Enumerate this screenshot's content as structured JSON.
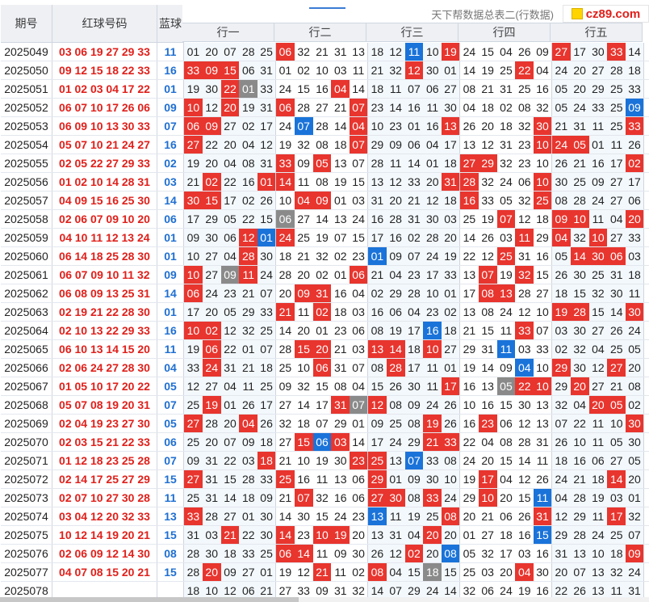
{
  "header": {
    "period_label": "期号",
    "red_label": "红球号码",
    "blue_label": "蓝球",
    "table_title": "天下帮数据总表二(行数据)",
    "groups": [
      "行一",
      "行二",
      "行三",
      "行四",
      "行五"
    ],
    "logo_text": "cz89.com"
  },
  "colors": {
    "red": "#e8352e",
    "blue": "#1a73d9",
    "gray": "#8a8a8a"
  },
  "rows": [
    {
      "period": "2025049",
      "red": "03 06 19 27 29 33",
      "blue": "11",
      "cells": [
        "01",
        "20",
        "07",
        "28",
        "25",
        "06",
        "32",
        "21",
        "31",
        "13",
        "18",
        "12",
        "11",
        "10",
        "19",
        "24",
        "15",
        "04",
        "26",
        "09",
        "27",
        "17",
        "30",
        "33",
        "14"
      ],
      "marks": {
        "5": "r",
        "12": "b",
        "14": "r",
        "20": "r",
        "23": "r"
      }
    },
    {
      "period": "2025050",
      "red": "09 12 15 18 22 33",
      "blue": "16",
      "cells": [
        "33",
        "09",
        "15",
        "06",
        "31",
        "01",
        "02",
        "10",
        "03",
        "11",
        "21",
        "32",
        "12",
        "30",
        "01",
        "14",
        "19",
        "25",
        "22",
        "04",
        "24",
        "20",
        "27",
        "28",
        "18"
      ],
      "marks": {
        "0": "r",
        "1": "r",
        "2": "r",
        "12": "r",
        "18": "r"
      }
    },
    {
      "period": "2025051",
      "red": "01 02 03 04 17 22",
      "blue": "01",
      "cells": [
        "19",
        "30",
        "22",
        "01",
        "33",
        "24",
        "15",
        "16",
        "04",
        "14",
        "18",
        "11",
        "07",
        "06",
        "27",
        "08",
        "21",
        "31",
        "25",
        "16",
        "05",
        "20",
        "29",
        "25",
        "33"
      ],
      "marks": {
        "2": "r",
        "3": "g",
        "8": "r"
      }
    },
    {
      "period": "2025052",
      "red": "06 07 10 17 26 06",
      "blue": "09",
      "cells": [
        "10",
        "12",
        "20",
        "19",
        "31",
        "06",
        "28",
        "27",
        "21",
        "07",
        "23",
        "14",
        "16",
        "11",
        "30",
        "04",
        "18",
        "02",
        "08",
        "32",
        "05",
        "24",
        "33",
        "25",
        "09"
      ],
      "marks": {
        "0": "r",
        "2": "r",
        "5": "r",
        "9": "r",
        "24": "b"
      }
    },
    {
      "period": "2025053",
      "red": "06 09 10 13 30 33",
      "blue": "07",
      "cells": [
        "06",
        "09",
        "27",
        "02",
        "17",
        "24",
        "07",
        "28",
        "14",
        "04",
        "10",
        "23",
        "01",
        "16",
        "13",
        "26",
        "20",
        "18",
        "32",
        "30",
        "21",
        "31",
        "11",
        "25",
        "33"
      ],
      "marks": {
        "0": "r",
        "1": "r",
        "6": "b",
        "9": "r",
        "14": "r",
        "19": "r",
        "24": "r"
      }
    },
    {
      "period": "2025054",
      "red": "05 07 10 21 24 27",
      "blue": "16",
      "cells": [
        "27",
        "22",
        "20",
        "04",
        "12",
        "19",
        "32",
        "08",
        "18",
        "07",
        "29",
        "09",
        "06",
        "04",
        "17",
        "13",
        "12",
        "31",
        "23",
        "10",
        "24",
        "05",
        "01",
        "11",
        "26"
      ],
      "marks": {
        "0": "r",
        "9": "r",
        "19": "r",
        "20": "r",
        "21": "r"
      }
    },
    {
      "period": "2025055",
      "red": "02 05 22 27 29 33",
      "blue": "02",
      "cells": [
        "19",
        "20",
        "04",
        "08",
        "31",
        "33",
        "09",
        "05",
        "13",
        "07",
        "28",
        "11",
        "14",
        "01",
        "18",
        "27",
        "29",
        "32",
        "23",
        "10",
        "26",
        "21",
        "16",
        "17",
        "02"
      ],
      "marks": {
        "5": "r",
        "7": "r",
        "15": "r",
        "16": "r",
        "24": "r"
      }
    },
    {
      "period": "2025056",
      "red": "01 02 10 14 28 31",
      "blue": "03",
      "cells": [
        "21",
        "02",
        "22",
        "16",
        "01",
        "14",
        "11",
        "08",
        "19",
        "15",
        "13",
        "12",
        "33",
        "20",
        "31",
        "28",
        "32",
        "24",
        "06",
        "10",
        "30",
        "25",
        "09",
        "27",
        "17"
      ],
      "marks": {
        "1": "r",
        "4": "r",
        "5": "r",
        "14": "r",
        "15": "r",
        "19": "r"
      }
    },
    {
      "period": "2025057",
      "red": "04 09 15 16 25 30",
      "blue": "14",
      "cells": [
        "30",
        "15",
        "17",
        "02",
        "26",
        "10",
        "04",
        "09",
        "01",
        "03",
        "31",
        "20",
        "21",
        "12",
        "18",
        "16",
        "33",
        "05",
        "32",
        "25",
        "08",
        "28",
        "24",
        "27",
        "06"
      ],
      "marks": {
        "0": "r",
        "1": "r",
        "6": "r",
        "7": "r",
        "15": "r",
        "19": "r"
      }
    },
    {
      "period": "2025058",
      "red": "02 06 07 09 10 20",
      "blue": "06",
      "cells": [
        "17",
        "29",
        "05",
        "22",
        "15",
        "06",
        "27",
        "14",
        "13",
        "24",
        "16",
        "28",
        "31",
        "30",
        "03",
        "25",
        "19",
        "07",
        "12",
        "18",
        "09",
        "10",
        "11",
        "04",
        "20"
      ],
      "marks": {
        "5": "g",
        "17": "r",
        "20": "r",
        "21": "r",
        "24": "r"
      }
    },
    {
      "period": "2025059",
      "red": "04 10 11 12 13 24",
      "blue": "01",
      "cells": [
        "09",
        "30",
        "06",
        "12",
        "01",
        "24",
        "25",
        "19",
        "07",
        "15",
        "17",
        "16",
        "02",
        "28",
        "20",
        "14",
        "26",
        "03",
        "11",
        "29",
        "04",
        "32",
        "10",
        "27",
        "33"
      ],
      "marks": {
        "3": "r",
        "4": "b",
        "5": "r",
        "18": "r",
        "20": "r",
        "22": "r"
      }
    },
    {
      "period": "2025060",
      "red": "06 14 18 25 28 30",
      "blue": "01",
      "cells": [
        "10",
        "27",
        "04",
        "28",
        "30",
        "18",
        "21",
        "32",
        "02",
        "23",
        "01",
        "09",
        "07",
        "24",
        "19",
        "22",
        "12",
        "25",
        "31",
        "16",
        "05",
        "14",
        "30",
        "06",
        "03"
      ],
      "marks": {
        "3": "r",
        "10": "b",
        "17": "r",
        "21": "r",
        "22": "r",
        "23": "r"
      }
    },
    {
      "period": "2025061",
      "red": "06 07 09 10 11 32",
      "blue": "09",
      "cells": [
        "10",
        "27",
        "09",
        "11",
        "24",
        "28",
        "20",
        "02",
        "01",
        "06",
        "21",
        "04",
        "23",
        "17",
        "33",
        "13",
        "07",
        "19",
        "32",
        "15",
        "26",
        "30",
        "25",
        "31",
        "18"
      ],
      "marks": {
        "0": "r",
        "2": "g",
        "3": "r",
        "9": "r",
        "16": "r",
        "18": "r"
      }
    },
    {
      "period": "2025062",
      "red": "06 08 09 13 25 31",
      "blue": "14",
      "cells": [
        "06",
        "24",
        "23",
        "21",
        "07",
        "20",
        "09",
        "31",
        "16",
        "04",
        "02",
        "29",
        "28",
        "10",
        "01",
        "17",
        "08",
        "13",
        "28",
        "27",
        "18",
        "15",
        "32",
        "30",
        "11"
      ],
      "marks": {
        "0": "r",
        "6": "r",
        "7": "r",
        "16": "r",
        "17": "r"
      }
    },
    {
      "period": "2025063",
      "red": "02 19 21 22 28 30",
      "blue": "01",
      "cells": [
        "17",
        "20",
        "05",
        "29",
        "33",
        "21",
        "11",
        "02",
        "18",
        "03",
        "16",
        "06",
        "04",
        "23",
        "02",
        "13",
        "08",
        "24",
        "12",
        "10",
        "19",
        "28",
        "15",
        "14",
        "30"
      ],
      "marks": {
        "5": "r",
        "7": "r",
        "20": "r",
        "21": "r",
        "24": "r"
      }
    },
    {
      "period": "2025064",
      "red": "02 10 13 22 29 33",
      "blue": "16",
      "cells": [
        "10",
        "02",
        "12",
        "32",
        "25",
        "14",
        "20",
        "01",
        "23",
        "06",
        "08",
        "19",
        "17",
        "16",
        "18",
        "21",
        "15",
        "11",
        "33",
        "07",
        "03",
        "30",
        "27",
        "26",
        "24"
      ],
      "marks": {
        "0": "r",
        "1": "r",
        "13": "b",
        "18": "r"
      }
    },
    {
      "period": "2025065",
      "red": "06 10 13 14 15 20",
      "blue": "11",
      "cells": [
        "19",
        "06",
        "22",
        "01",
        "07",
        "28",
        "15",
        "20",
        "21",
        "03",
        "13",
        "14",
        "18",
        "10",
        "27",
        "29",
        "31",
        "11",
        "03",
        "33",
        "02",
        "32",
        "04",
        "25",
        "05"
      ],
      "marks": {
        "1": "r",
        "6": "r",
        "7": "r",
        "10": "r",
        "11": "r",
        "13": "r",
        "17": "b"
      }
    },
    {
      "period": "2025066",
      "red": "02 06 24 27 28 30",
      "blue": "04",
      "cells": [
        "33",
        "24",
        "31",
        "21",
        "18",
        "25",
        "10",
        "06",
        "31",
        "07",
        "08",
        "28",
        "17",
        "11",
        "01",
        "19",
        "14",
        "09",
        "04",
        "10",
        "29",
        "30",
        "12",
        "27",
        "20"
      ],
      "marks": {
        "1": "r",
        "7": "r",
        "11": "r",
        "18": "b",
        "20": "r",
        "23": "r"
      }
    },
    {
      "period": "2025067",
      "red": "01 05 10 17 20 22",
      "blue": "05",
      "cells": [
        "12",
        "27",
        "04",
        "11",
        "25",
        "09",
        "32",
        "15",
        "08",
        "04",
        "15",
        "26",
        "30",
        "11",
        "17",
        "16",
        "13",
        "05",
        "22",
        "10",
        "29",
        "20",
        "27",
        "21",
        "08"
      ],
      "marks": {
        "14": "r",
        "17": "g",
        "18": "r",
        "19": "r",
        "21": "r"
      }
    },
    {
      "period": "2025068",
      "red": "05 07 08 19 20 31",
      "blue": "07",
      "cells": [
        "25",
        "19",
        "01",
        "26",
        "17",
        "27",
        "14",
        "17",
        "31",
        "07",
        "12",
        "08",
        "09",
        "24",
        "26",
        "10",
        "16",
        "15",
        "30",
        "13",
        "32",
        "04",
        "20",
        "05",
        "02"
      ],
      "marks": {
        "1": "r",
        "8": "r",
        "9": "g",
        "10": "r",
        "22": "r",
        "23": "r"
      }
    },
    {
      "period": "2025069",
      "red": "02 04 19 23 27 30",
      "blue": "05",
      "cells": [
        "27",
        "28",
        "20",
        "04",
        "26",
        "32",
        "18",
        "07",
        "29",
        "01",
        "09",
        "25",
        "08",
        "19",
        "26",
        "16",
        "23",
        "06",
        "12",
        "13",
        "07",
        "22",
        "11",
        "10",
        "30"
      ],
      "marks": {
        "0": "r",
        "3": "r",
        "13": "r",
        "16": "r",
        "24": "r"
      }
    },
    {
      "period": "2025070",
      "red": "02 03 15 21 22 33",
      "blue": "06",
      "cells": [
        "25",
        "20",
        "07",
        "09",
        "18",
        "27",
        "15",
        "06",
        "03",
        "14",
        "17",
        "24",
        "29",
        "21",
        "33",
        "22",
        "04",
        "08",
        "28",
        "31",
        "26",
        "10",
        "11",
        "05",
        "30"
      ],
      "marks": {
        "6": "r",
        "7": "b",
        "8": "r",
        "13": "r",
        "14": "r"
      }
    },
    {
      "period": "2025071",
      "red": "01 12 18 23 25 28",
      "blue": "07",
      "cells": [
        "09",
        "31",
        "22",
        "03",
        "18",
        "21",
        "10",
        "19",
        "30",
        "23",
        "25",
        "13",
        "07",
        "33",
        "08",
        "24",
        "20",
        "15",
        "14",
        "11",
        "18",
        "16",
        "06",
        "27",
        "05"
      ],
      "marks": {
        "4": "r",
        "9": "r",
        "10": "r",
        "12": "b"
      }
    },
    {
      "period": "2025072",
      "red": "02 14 17 25 27 29",
      "blue": "15",
      "cells": [
        "27",
        "31",
        "15",
        "28",
        "33",
        "25",
        "16",
        "11",
        "13",
        "06",
        "29",
        "01",
        "09",
        "30",
        "10",
        "19",
        "17",
        "04",
        "12",
        "26",
        "24",
        "21",
        "18",
        "14",
        "20"
      ],
      "marks": {
        "0": "r",
        "5": "r",
        "10": "r",
        "16": "r",
        "23": "r"
      }
    },
    {
      "period": "2025073",
      "red": "02 07 10 27 30 28",
      "blue": "11",
      "cells": [
        "25",
        "31",
        "14",
        "18",
        "09",
        "21",
        "07",
        "32",
        "16",
        "06",
        "27",
        "30",
        "08",
        "33",
        "24",
        "29",
        "10",
        "20",
        "15",
        "11",
        "04",
        "28",
        "19",
        "03",
        "01"
      ],
      "marks": {
        "6": "r",
        "10": "r",
        "11": "r",
        "13": "r",
        "16": "r",
        "19": "b"
      }
    },
    {
      "period": "2025074",
      "red": "03 04 12 20 32 33",
      "blue": "13",
      "cells": [
        "33",
        "28",
        "27",
        "01",
        "30",
        "14",
        "30",
        "15",
        "24",
        "23",
        "13",
        "11",
        "19",
        "25",
        "08",
        "20",
        "21",
        "06",
        "26",
        "31",
        "12",
        "29",
        "11",
        "17",
        "32",
        "02"
      ],
      "marks": {
        "0": "r",
        "10": "b",
        "14": "r",
        "19": "r",
        "23": "r"
      }
    },
    {
      "period": "2025075",
      "red": "10 12 14 19 20 21",
      "blue": "15",
      "cells": [
        "31",
        "03",
        "21",
        "22",
        "30",
        "14",
        "23",
        "10",
        "19",
        "20",
        "13",
        "31",
        "04",
        "20",
        "20",
        "01",
        "27",
        "18",
        "16",
        "15",
        "29",
        "28",
        "24",
        "25",
        "07"
      ],
      "marks": {
        "2": "r",
        "5": "r",
        "7": "r",
        "8": "r",
        "13": "r",
        "19": "b"
      }
    },
    {
      "period": "2025076",
      "red": "02 06 09 12 14 30",
      "blue": "08",
      "cells": [
        "28",
        "30",
        "18",
        "33",
        "25",
        "06",
        "14",
        "11",
        "09",
        "30",
        "26",
        "12",
        "02",
        "20",
        "08",
        "05",
        "32",
        "17",
        "03",
        "16",
        "31",
        "13",
        "10",
        "18",
        "09"
      ],
      "marks": {
        "5": "r",
        "6": "r",
        "12": "r",
        "14": "b",
        "24": "r"
      }
    },
    {
      "period": "2025077",
      "red": "04 07 08 15 20 21",
      "blue": "15",
      "cells": [
        "28",
        "20",
        "09",
        "27",
        "01",
        "19",
        "12",
        "21",
        "11",
        "02",
        "08",
        "04",
        "15",
        "18",
        "15",
        "25",
        "03",
        "20",
        "04",
        "30",
        "20",
        "07",
        "13",
        "32",
        "24"
      ],
      "marks": {
        "1": "r",
        "7": "r",
        "10": "r",
        "13": "g",
        "18": "r"
      }
    },
    {
      "period": "2025078",
      "red": "",
      "blue": "",
      "cells": [
        "18",
        "10",
        "12",
        "06",
        "21",
        "27",
        "33",
        "09",
        "31",
        "32",
        "14",
        "07",
        "29",
        "24",
        "14",
        "32",
        "06",
        "24",
        "19",
        "16",
        "22",
        "26",
        "13",
        "11",
        "31"
      ],
      "marks": {}
    }
  ]
}
